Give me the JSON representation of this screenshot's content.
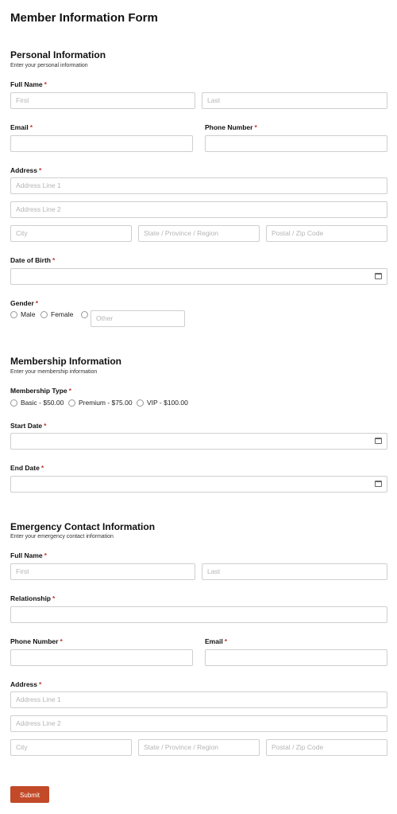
{
  "form_title": "Member Information Form",
  "required_mark": "*",
  "personal": {
    "title": "Personal Information",
    "description": "Enter your personal information",
    "full_name": {
      "label": "Full Name",
      "first_placeholder": "First",
      "last_placeholder": "Last"
    },
    "email": {
      "label": "Email"
    },
    "phone": {
      "label": "Phone Number"
    },
    "address": {
      "label": "Address",
      "line1_placeholder": "Address Line 1",
      "line2_placeholder": "Address Line 2",
      "city_placeholder": "City",
      "state_placeholder": "State / Province / Region",
      "postal_placeholder": "Postal / Zip Code"
    },
    "dob": {
      "label": "Date of Birth",
      "icon": "calendar-icon"
    },
    "gender": {
      "label": "Gender",
      "options": [
        "Male",
        "Female"
      ],
      "other_placeholder": "Other"
    }
  },
  "membership": {
    "title": "Membership Information",
    "description": "Enter your membership information",
    "type": {
      "label": "Membership Type",
      "options": [
        "Basic - $50.00",
        "Premium - $75.00",
        "VIP - $100.00"
      ]
    },
    "start_date": {
      "label": "Start Date",
      "icon": "calendar-icon"
    },
    "end_date": {
      "label": "End Date",
      "icon": "calendar-icon"
    }
  },
  "emergency": {
    "title": "Emergency Contact Information",
    "description": "Enter your emergency contact information",
    "full_name": {
      "label": "Full Name",
      "first_placeholder": "First",
      "last_placeholder": "Last"
    },
    "relationship": {
      "label": "Relationship"
    },
    "phone": {
      "label": "Phone Number"
    },
    "email": {
      "label": "Email"
    },
    "address": {
      "label": "Address",
      "line1_placeholder": "Address Line 1",
      "line2_placeholder": "Address Line 2",
      "city_placeholder": "City",
      "state_placeholder": "State / Province / Region",
      "postal_placeholder": "Postal / Zip Code"
    }
  },
  "submit_label": "Submit",
  "colors": {
    "accent": "#c24a28",
    "required": "#c0392b",
    "border": "#cfcfcf"
  }
}
